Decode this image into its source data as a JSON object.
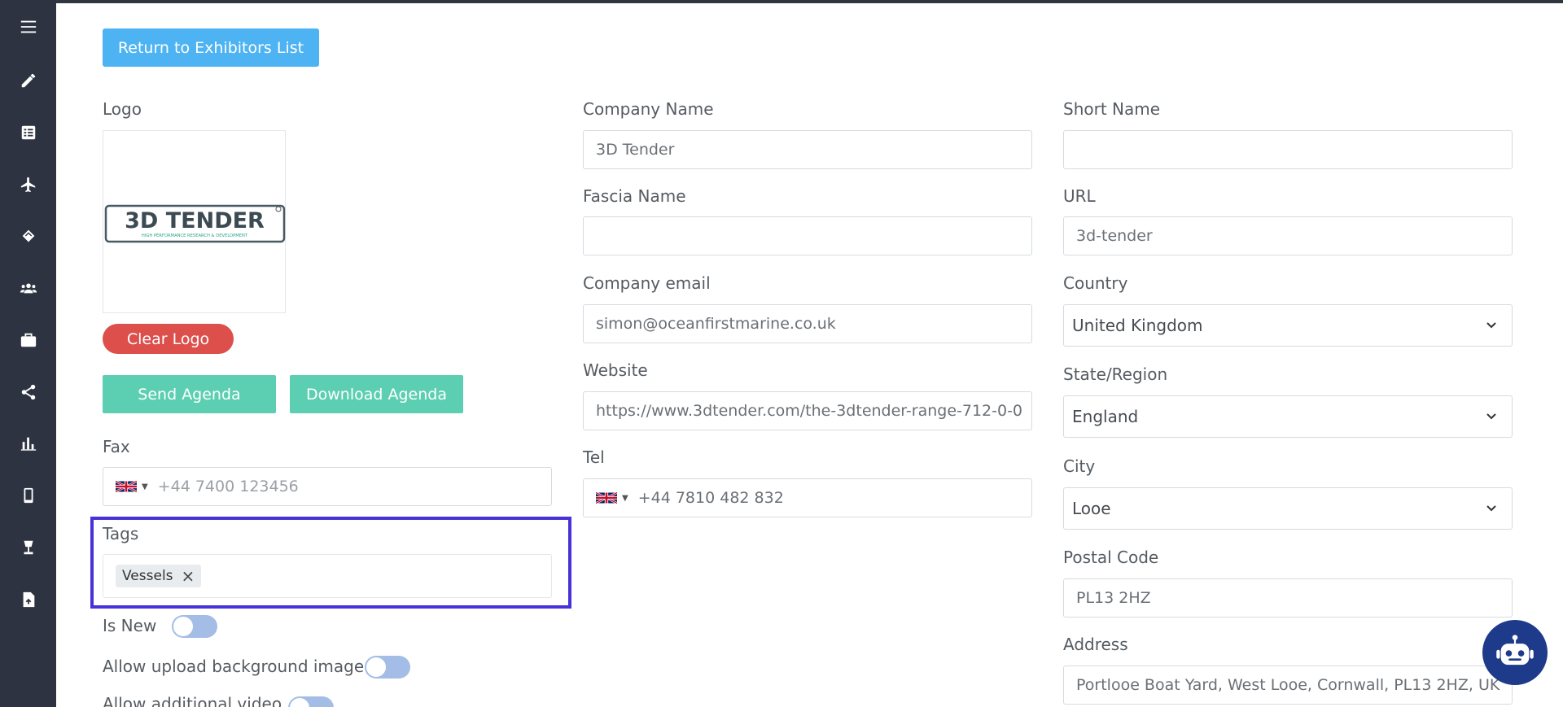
{
  "sidebar": {
    "icons": [
      "menu-icon",
      "pencil-icon",
      "list-icon",
      "plane-icon",
      "handshake-icon",
      "users-icon",
      "briefcase-icon",
      "share-icon",
      "bar-chart-icon",
      "mobile-icon",
      "lamp-icon",
      "file-upload-icon"
    ]
  },
  "actions": {
    "return_label": "Return to Exhibitors List",
    "clear_logo_label": "Clear Logo",
    "send_agenda_label": "Send Agenda",
    "download_agenda_label": "Download Agenda"
  },
  "logo": {
    "label": "Logo",
    "brand_text": "3D TENDER",
    "brand_subtext": "HIGH PERFORMANCE RESEARCH & DEVELOPMENT"
  },
  "fax": {
    "label": "Fax",
    "placeholder": "+44 7400 123456"
  },
  "tags": {
    "label": "Tags",
    "items": [
      "Vessels"
    ],
    "remove_glyph": "×"
  },
  "toggles": {
    "is_new": "Is New",
    "allow_bg": "Allow upload background image",
    "allow_video": "Allow additional video"
  },
  "company": {
    "name_label": "Company Name",
    "name_value": "3D Tender",
    "fascia_label": "Fascia Name",
    "fascia_value": "",
    "email_label": "Company email",
    "email_value": "simon@oceanfirstmarine.co.uk",
    "website_label": "Website",
    "website_value": "https://www.3dtender.com/the-3dtender-range-712-0-0",
    "tel_label": "Tel",
    "tel_value": "+44 7810 482 832"
  },
  "location": {
    "short_label": "Short Name",
    "short_value": "",
    "url_label": "URL",
    "url_value": "3d-tender",
    "country_label": "Country",
    "country_value": "United Kingdom",
    "state_label": "State/Region",
    "state_value": "England",
    "city_label": "City",
    "city_value": "Looe",
    "postal_label": "Postal Code",
    "postal_value": "PL13 2HZ",
    "address_label": "Address",
    "address_value": "Portlooe Boat Yard, West Looe, Cornwall, PL13 2HZ, UK"
  },
  "colors": {
    "sidebar": "#2d3340",
    "primary_button": "#4db3f2",
    "danger_button": "#dc4f4b",
    "teal_button": "#5ccfb2",
    "highlight": "#4632d8",
    "toggle_off": "#a3bde6"
  }
}
